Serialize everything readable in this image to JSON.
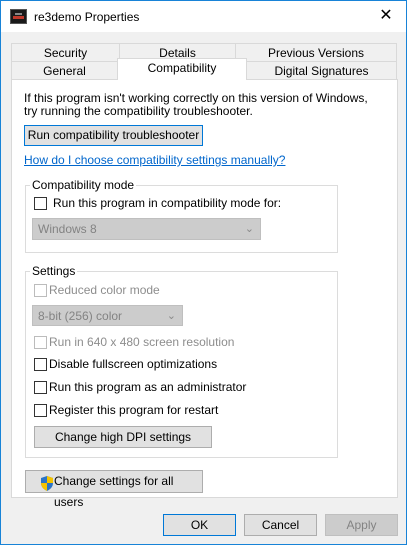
{
  "window": {
    "title": "re3demo Properties",
    "close_glyph": "✕"
  },
  "tabs_row1": [
    {
      "label": "Security"
    },
    {
      "label": "Details"
    },
    {
      "label": "Previous Versions"
    }
  ],
  "tabs_row2": [
    {
      "label": "General"
    },
    {
      "label": "Compatibility",
      "active": true
    },
    {
      "label": "Digital Signatures"
    }
  ],
  "intro": {
    "line1": "If this program isn't working correctly on this version of Windows,",
    "line2": "try running the compatibility troubleshooter."
  },
  "troubleshooter_button": "Run compatibility troubleshooter",
  "manual_link": "How do I choose compatibility settings manually?",
  "compat_mode": {
    "group_label": "Compatibility mode",
    "checkbox_label": "Run this program in compatibility mode for:",
    "checked": false,
    "os_select_value": "Windows 8"
  },
  "settings": {
    "group_label": "Settings",
    "reduced_color": {
      "label": "Reduced color mode",
      "checked": false,
      "disabled": true
    },
    "color_select_value": "8-bit (256) color",
    "resolution_640": {
      "label": "Run in 640 x 480 screen resolution",
      "checked": false,
      "disabled": true
    },
    "disable_fullscreen": {
      "label": "Disable fullscreen optimizations",
      "checked": false
    },
    "run_as_admin": {
      "label": "Run this program as an administrator",
      "checked": false
    },
    "register_restart": {
      "label": "Register this program for restart",
      "checked": false
    },
    "dpi_button": "Change high DPI settings"
  },
  "all_users_button": "Change settings for all users",
  "footer": {
    "ok": "OK",
    "cancel": "Cancel",
    "apply": "Apply"
  },
  "colors": {
    "accent": "#0078d7",
    "link": "#0066cc",
    "window_border": "#1883d7",
    "shield_blue": "#2b74c7",
    "shield_yellow": "#f5c400"
  }
}
